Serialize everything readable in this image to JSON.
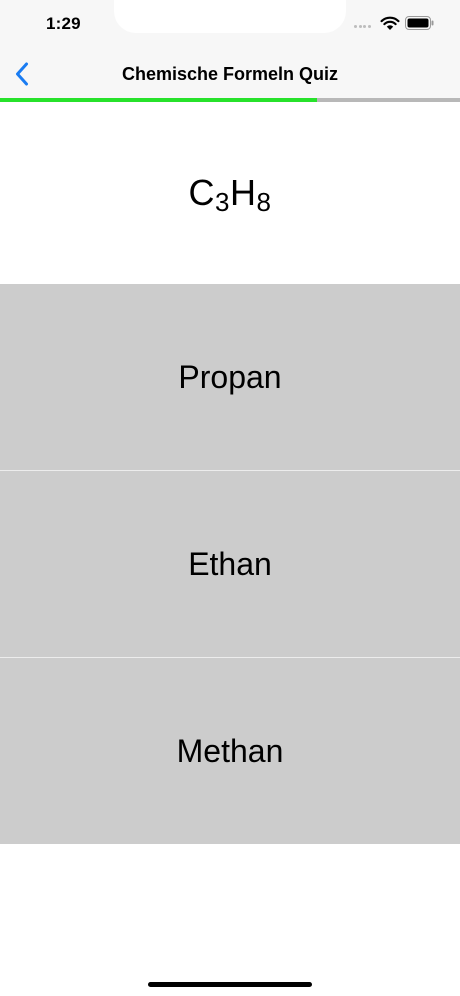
{
  "status_bar": {
    "time": "1:29"
  },
  "nav": {
    "title": "Chemische Formeln Quiz",
    "back_icon": "chevron-left-icon"
  },
  "progress": {
    "fraction": 0.69,
    "fill_color": "#27e22b",
    "track_color": "#b8b8b8"
  },
  "question": {
    "formula_parts": [
      "C",
      "3",
      "H",
      "8"
    ]
  },
  "answers": [
    {
      "label": "Propan"
    },
    {
      "label": "Ethan"
    },
    {
      "label": "Methan"
    }
  ],
  "colors": {
    "accent": "#1a7cf2",
    "answer_background": "#cccccc",
    "bar_background": "#f7f7f7"
  }
}
